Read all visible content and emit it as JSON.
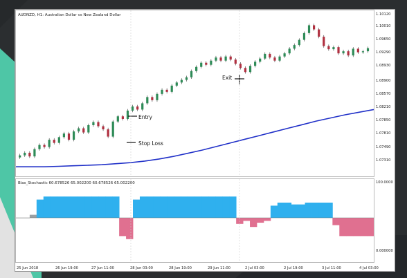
{
  "window": {
    "title": "AUDNZD, H1: Australian Dollar vs New Zealand Dollar",
    "indicator_title": "Bias_Stochastic 60.678526 65.002200 60.678526 65.002200"
  },
  "price_axis": {
    "labels": [
      "1.10120",
      "1.10010",
      "1.09650",
      "1.09290",
      "1.08930",
      "1.08900",
      "1.08570",
      "1.08210",
      "1.07850",
      "1.07810",
      "1.07490",
      "1.07310"
    ]
  },
  "indicator_axis": {
    "top_label": "100.0000",
    "bottom_label": "0.000000"
  },
  "time_axis": {
    "labels": [
      "25 Jun 2018",
      "26 Jun 19:00",
      "27 Jun 11:00",
      "28 Jun 03:00",
      "28 Jun 19:00",
      "29 Jun 11:00",
      "2 Jul 03:00",
      "2 Jul 19:00",
      "3 Jul 11:00",
      "4 Jul 03:00"
    ]
  },
  "annotations": {
    "entry": "Entry",
    "stop_loss": "Stop Loss",
    "exit": "Exit"
  },
  "colors": {
    "bull_candle": "#2e8b57",
    "bear_candle": "#b03040",
    "moving_average": "#2030c8",
    "indicator_bull": "#2fb0ee",
    "indicator_bear": "#e07090",
    "background": "#2b2e30"
  },
  "chart_data": {
    "type": "candlestick",
    "symbol": "AUDNZD",
    "timeframe": "H1",
    "close": [
      1.074,
      1.0745,
      1.0738,
      1.0752,
      1.076,
      1.0756,
      1.077,
      1.0764,
      1.0775,
      1.0782,
      1.077,
      1.0786,
      1.0792,
      1.0784,
      1.0798,
      1.0804,
      1.0796,
      1.079,
      1.0776,
      1.0805,
      1.0815,
      1.081,
      1.0826,
      1.0834,
      1.0828,
      1.084,
      1.0852,
      1.0846,
      1.0858,
      1.0866,
      1.0862,
      1.0874,
      1.088,
      1.0885,
      1.089,
      1.0902,
      1.091,
      1.0918,
      1.0914,
      1.0922,
      1.0928,
      1.0922,
      1.093,
      1.0924,
      1.0916,
      1.0908,
      1.09,
      1.0912,
      1.092,
      1.0926,
      1.0935,
      1.0928,
      1.0922,
      1.093,
      1.0936,
      1.0945,
      1.0952,
      1.0962,
      1.0975,
      1.099,
      1.0982,
      1.0968,
      1.095,
      1.0944,
      1.0948,
      1.0936,
      1.094,
      1.0932,
      1.0945,
      1.0938,
      1.094,
      1.0946
    ],
    "moving_average": [
      1.0718,
      1.0718,
      1.0718,
      1.0719,
      1.072,
      1.0721,
      1.0722,
      1.0724,
      1.0726,
      1.0729,
      1.0733,
      1.0738,
      1.0744,
      1.075,
      1.0757,
      1.0764,
      1.0771,
      1.0778,
      1.0785,
      1.0792,
      1.0799,
      1.0806,
      1.0812,
      1.0818,
      1.0823,
      1.0828
    ],
    "indicator": [
      50,
      50,
      55,
      80,
      85,
      85,
      85,
      85,
      85,
      85,
      85,
      85,
      85,
      85,
      85,
      20,
      15,
      80,
      85,
      85,
      85,
      85,
      85,
      85,
      85,
      85,
      85,
      85,
      85,
      85,
      85,
      85,
      40,
      45,
      35,
      42,
      45,
      70,
      75,
      75,
      72,
      72,
      75,
      75,
      75,
      75,
      38,
      20,
      20,
      20,
      20,
      20
    ],
    "indicator_range": [
      0,
      100
    ]
  }
}
